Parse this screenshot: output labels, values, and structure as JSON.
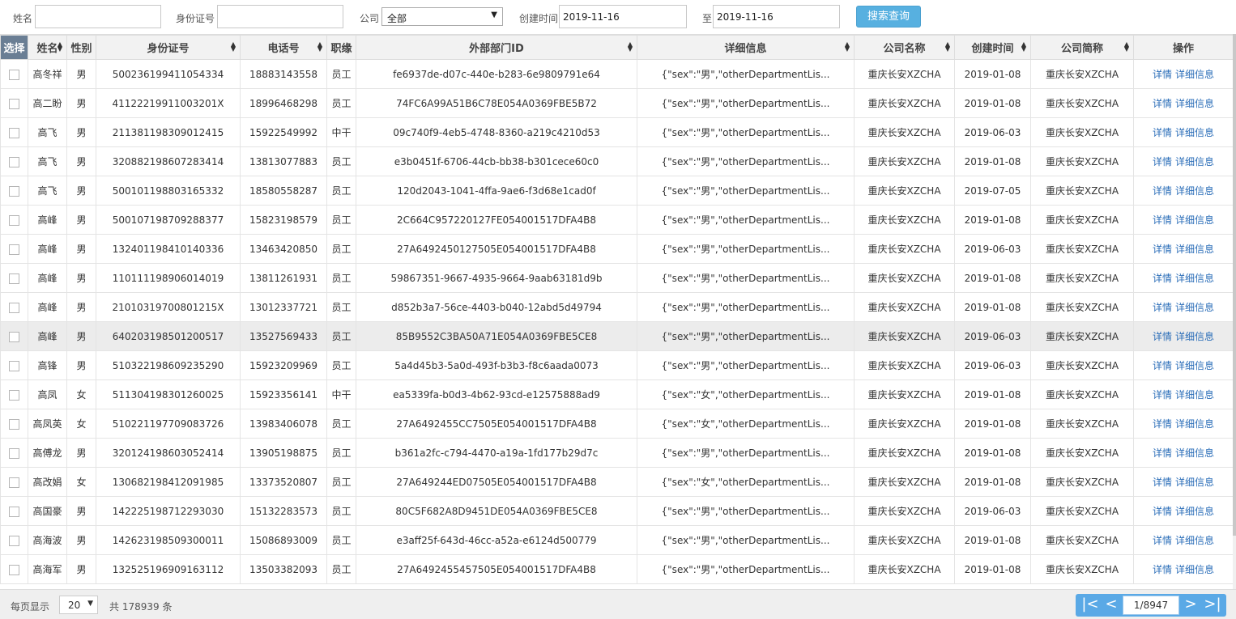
{
  "search": {
    "name_label": "姓名",
    "name_value": "",
    "id_label": "身份证号",
    "id_value": "",
    "company_label": "公司",
    "company_selected": "全部",
    "created_label": "创建时间",
    "created_from": "2019-11-16",
    "to_label": "至",
    "created_to": "2019-11-16",
    "search_button": "搜索查询"
  },
  "table": {
    "headers": [
      "选择",
      "姓名",
      "性别",
      "身份证号",
      "电话号",
      "职缘",
      "外部部门ID",
      "详细信息",
      "公司名称",
      "创建时间",
      "公司简称",
      "操作"
    ],
    "action_links": [
      "详情",
      "详细信息"
    ],
    "rows": [
      [
        "高冬祥",
        "男",
        "500236199411054334",
        "18883143558",
        "员工",
        "fe6937de-d07c-440e-b283-6e9809791e64",
        "{\"sex\":\"男\",\"otherDepartmentLis...",
        "重庆长安XZCHA",
        "2019-01-08",
        "重庆长安XZCHA"
      ],
      [
        "高二盼",
        "男",
        "41122219911003201X",
        "18996468298",
        "员工",
        "74FC6A99A51B6C78E054A0369FBE5B72",
        "{\"sex\":\"男\",\"otherDepartmentLis...",
        "重庆长安XZCHA",
        "2019-01-08",
        "重庆长安XZCHA"
      ],
      [
        "高飞",
        "男",
        "211381198309012415",
        "15922549992",
        "中干",
        "09c740f9-4eb5-4748-8360-a219c4210d53",
        "{\"sex\":\"男\",\"otherDepartmentLis...",
        "重庆长安XZCHA",
        "2019-06-03",
        "重庆长安XZCHA"
      ],
      [
        "高飞",
        "男",
        "320882198607283414",
        "13813077883",
        "员工",
        "e3b0451f-6706-44cb-bb38-b301cece60c0",
        "{\"sex\":\"男\",\"otherDepartmentLis...",
        "重庆长安XZCHA",
        "2019-01-08",
        "重庆长安XZCHA"
      ],
      [
        "高飞",
        "男",
        "500101198803165332",
        "18580558287",
        "员工",
        "120d2043-1041-4ffa-9ae6-f3d68e1cad0f",
        "{\"sex\":\"男\",\"otherDepartmentLis...",
        "重庆长安XZCHA",
        "2019-07-05",
        "重庆长安XZCHA"
      ],
      [
        "高峰",
        "男",
        "500107198709288377",
        "15823198579",
        "员工",
        "2C664C957220127FE054001517DFA4B8",
        "{\"sex\":\"男\",\"otherDepartmentLis...",
        "重庆长安XZCHA",
        "2019-01-08",
        "重庆长安XZCHA"
      ],
      [
        "高峰",
        "男",
        "132401198410140336",
        "13463420850",
        "员工",
        "27A6492450127505E054001517DFA4B8",
        "{\"sex\":\"男\",\"otherDepartmentLis...",
        "重庆长安XZCHA",
        "2019-06-03",
        "重庆长安XZCHA"
      ],
      [
        "高峰",
        "男",
        "110111198906014019",
        "13811261931",
        "员工",
        "59867351-9667-4935-9664-9aab63181d9b",
        "{\"sex\":\"男\",\"otherDepartmentLis...",
        "重庆长安XZCHA",
        "2019-01-08",
        "重庆长安XZCHA"
      ],
      [
        "高峰",
        "男",
        "21010319700801215X",
        "13012337721",
        "员工",
        "d852b3a7-56ce-4403-b040-12abd5d49794",
        "{\"sex\":\"男\",\"otherDepartmentLis...",
        "重庆长安XZCHA",
        "2019-01-08",
        "重庆长安XZCHA"
      ],
      [
        "高峰",
        "男",
        "640203198501200517",
        "13527569433",
        "员工",
        "85B9552C3BA50A71E054A0369FBE5CE8",
        "{\"sex\":\"男\",\"otherDepartmentLis...",
        "重庆长安XZCHA",
        "2019-06-03",
        "重庆长安XZCHA"
      ],
      [
        "高锋",
        "男",
        "510322198609235290",
        "15923209969",
        "员工",
        "5a4d45b3-5a0d-493f-b3b3-f8c6aada0073",
        "{\"sex\":\"男\",\"otherDepartmentLis...",
        "重庆长安XZCHA",
        "2019-06-03",
        "重庆长安XZCHA"
      ],
      [
        "高凤",
        "女",
        "511304198301260025",
        "15923356141",
        "中干",
        "ea5339fa-b0d3-4b62-93cd-e12575888ad9",
        "{\"sex\":\"女\",\"otherDepartmentLis...",
        "重庆长安XZCHA",
        "2019-01-08",
        "重庆长安XZCHA"
      ],
      [
        "高凤英",
        "女",
        "510221197709083726",
        "13983406078",
        "员工",
        "27A6492455CC7505E054001517DFA4B8",
        "{\"sex\":\"女\",\"otherDepartmentLis...",
        "重庆长安XZCHA",
        "2019-01-08",
        "重庆长安XZCHA"
      ],
      [
        "高傅龙",
        "男",
        "320124198603052414",
        "13905198875",
        "员工",
        "b361a2fc-c794-4470-a19a-1fd177b29d7c",
        "{\"sex\":\"男\",\"otherDepartmentLis...",
        "重庆长安XZCHA",
        "2019-01-08",
        "重庆长安XZCHA"
      ],
      [
        "高改娟",
        "女",
        "130682198412091985",
        "13373520807",
        "员工",
        "27A649244ED07505E054001517DFA4B8",
        "{\"sex\":\"女\",\"otherDepartmentLis...",
        "重庆长安XZCHA",
        "2019-01-08",
        "重庆长安XZCHA"
      ],
      [
        "高国豪",
        "男",
        "142225198712293030",
        "15132283573",
        "员工",
        "80C5F682A8D9451DE054A0369FBE5CE8",
        "{\"sex\":\"男\",\"otherDepartmentLis...",
        "重庆长安XZCHA",
        "2019-06-03",
        "重庆长安XZCHA"
      ],
      [
        "高海波",
        "男",
        "142623198509300011",
        "15086893009",
        "员工",
        "e3aff25f-643d-46cc-a52a-e6124d500779",
        "{\"sex\":\"男\",\"otherDepartmentLis...",
        "重庆长安XZCHA",
        "2019-01-08",
        "重庆长安XZCHA"
      ],
      [
        "高海军",
        "男",
        "132525196909163112",
        "13503382093",
        "员工",
        "27A6492455457505E054001517DFA4B8",
        "{\"sex\":\"男\",\"otherDepartmentLis...",
        "重庆长安XZCHA",
        "2019-01-08",
        "重庆长安XZCHA"
      ]
    ]
  },
  "footer": {
    "per_page_label": "每页显示",
    "per_page_value": "20",
    "total_text": "共 178939 条",
    "page_text": "1/8947",
    "pager_icons": [
      "first-page-icon",
      "prev-page-icon",
      "next-page-icon",
      "last-page-icon"
    ]
  }
}
